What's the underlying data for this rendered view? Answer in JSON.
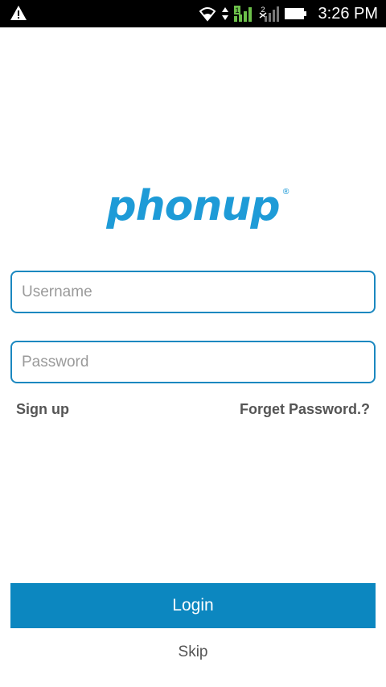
{
  "status_bar": {
    "time": "3:26 PM",
    "icons": [
      "warning-icon",
      "wifi-icon",
      "data-transfer-icon",
      "signal-sim1-icon",
      "signal-sim2-icon",
      "battery-icon"
    ],
    "signal_color": "#6cc04a"
  },
  "logo": {
    "text": "phonup",
    "registered_mark": "®",
    "color": "#1e9bd7"
  },
  "form": {
    "username_placeholder": "Username",
    "password_placeholder": "Password",
    "border_color": "#1b88c0"
  },
  "links": {
    "signup_label": "Sign up",
    "forget_label": "Forget Password.?"
  },
  "actions": {
    "login_label": "Login",
    "login_color": "#0c87c0",
    "skip_label": "Skip"
  }
}
